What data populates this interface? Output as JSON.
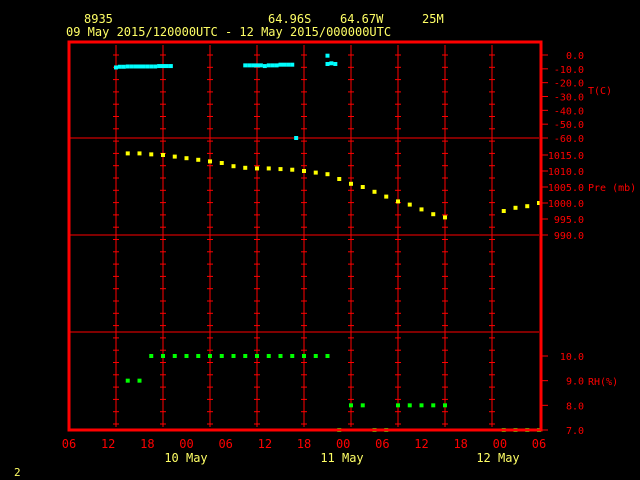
{
  "header": {
    "station_id": "8935",
    "latitude": "64.96S",
    "longitude": "64.67W",
    "elevation": "25M",
    "time_range": "09 May 2015/120000UTC - 12 May 2015/000000UTC"
  },
  "page_number": "2",
  "colors": {
    "background": "#000000",
    "frame": "#ff0000",
    "grid": "#ff0000",
    "text": "#ffff66",
    "temperature": "#00ffff",
    "pressure": "#ffff00",
    "humidity": "#00ff00"
  },
  "x_axis": {
    "hour_ticks": [
      "06",
      "12",
      "18",
      "00",
      "06",
      "12",
      "18",
      "00",
      "06",
      "12",
      "18",
      "00",
      "06"
    ],
    "day_labels": [
      "10 May",
      "11 May",
      "12 May"
    ]
  },
  "chart_data": [
    {
      "type": "scatter",
      "panel": "temperature",
      "ylabel": "T(C)",
      "ylim": [
        -60,
        0
      ],
      "ytick_labels": [
        "0.0",
        "-10.0",
        "-20.0",
        "-30.0",
        "-40.0",
        "-50.0",
        "-60.0"
      ],
      "x_unit": "hours from 09 May 2015 06 UTC",
      "x": [
        12,
        13,
        14,
        15,
        16,
        17,
        18,
        19,
        20,
        21,
        22,
        23,
        24,
        25,
        26,
        45,
        46,
        47,
        48,
        49,
        50,
        51,
        52,
        53,
        54,
        55,
        56,
        57,
        58,
        66,
        66,
        67,
        68
      ],
      "y": [
        -9,
        -8.5,
        -8.5,
        -8.3,
        -8.3,
        -8.3,
        -8.3,
        -8.3,
        -8.3,
        -8.3,
        -8.3,
        -8,
        -8,
        -8,
        -8,
        -7.5,
        -7.5,
        -7.5,
        -7.5,
        -7.5,
        -8,
        -7.5,
        -7.5,
        -7.5,
        -7,
        -7,
        -7,
        -7,
        -60,
        -0.5,
        -6.5,
        -6,
        -6.5
      ]
    },
    {
      "type": "scatter",
      "panel": "pressure",
      "ylabel": "Pre (mb)",
      "ylim": [
        990,
        1015
      ],
      "ytick_labels": [
        "1015.0",
        "1010.0",
        "1005.0",
        "1000.0",
        "995.0",
        "990.0"
      ],
      "x_unit": "hours from 09 May 2015 06 UTC",
      "x": [
        15,
        18,
        21,
        24,
        27,
        30,
        33,
        36,
        39,
        42,
        45,
        48,
        51,
        54,
        57,
        60,
        63,
        66,
        69,
        72,
        75,
        78,
        81,
        84,
        87,
        90,
        93,
        96,
        111,
        114,
        117,
        120
      ],
      "y": [
        1015.5,
        1015.5,
        1015.2,
        1015,
        1014.5,
        1014,
        1013.5,
        1013,
        1012.5,
        1011.5,
        1011,
        1010.8,
        1010.8,
        1010.6,
        1010.4,
        1010,
        1009.5,
        1009,
        1007.5,
        1006,
        1005,
        1003.5,
        1002,
        1000.5,
        999.5,
        998,
        996.5,
        995.5,
        997.5,
        998.5,
        999,
        1000
      ]
    },
    {
      "type": "scatter",
      "panel": "humidity",
      "ylabel": "RH(%)",
      "ylim": [
        7,
        10
      ],
      "ytick_labels": [
        "10.0",
        "9.0",
        "8.0",
        "7.0"
      ],
      "x_unit": "hours from 09 May 2015 06 UTC",
      "x": [
        15,
        18,
        21,
        24,
        27,
        30,
        33,
        36,
        39,
        42,
        45,
        48,
        51,
        54,
        57,
        60,
        63,
        66,
        69,
        72,
        75,
        78,
        81,
        84,
        87,
        90,
        93,
        96,
        111,
        114,
        117,
        120
      ],
      "y": [
        9,
        9,
        10,
        10,
        10,
        10,
        10,
        10,
        10,
        10,
        10,
        10,
        10,
        10,
        10,
        10,
        10,
        10,
        7,
        8,
        8,
        7,
        7,
        8,
        8,
        8,
        8,
        8,
        7,
        7,
        7,
        7
      ]
    }
  ]
}
